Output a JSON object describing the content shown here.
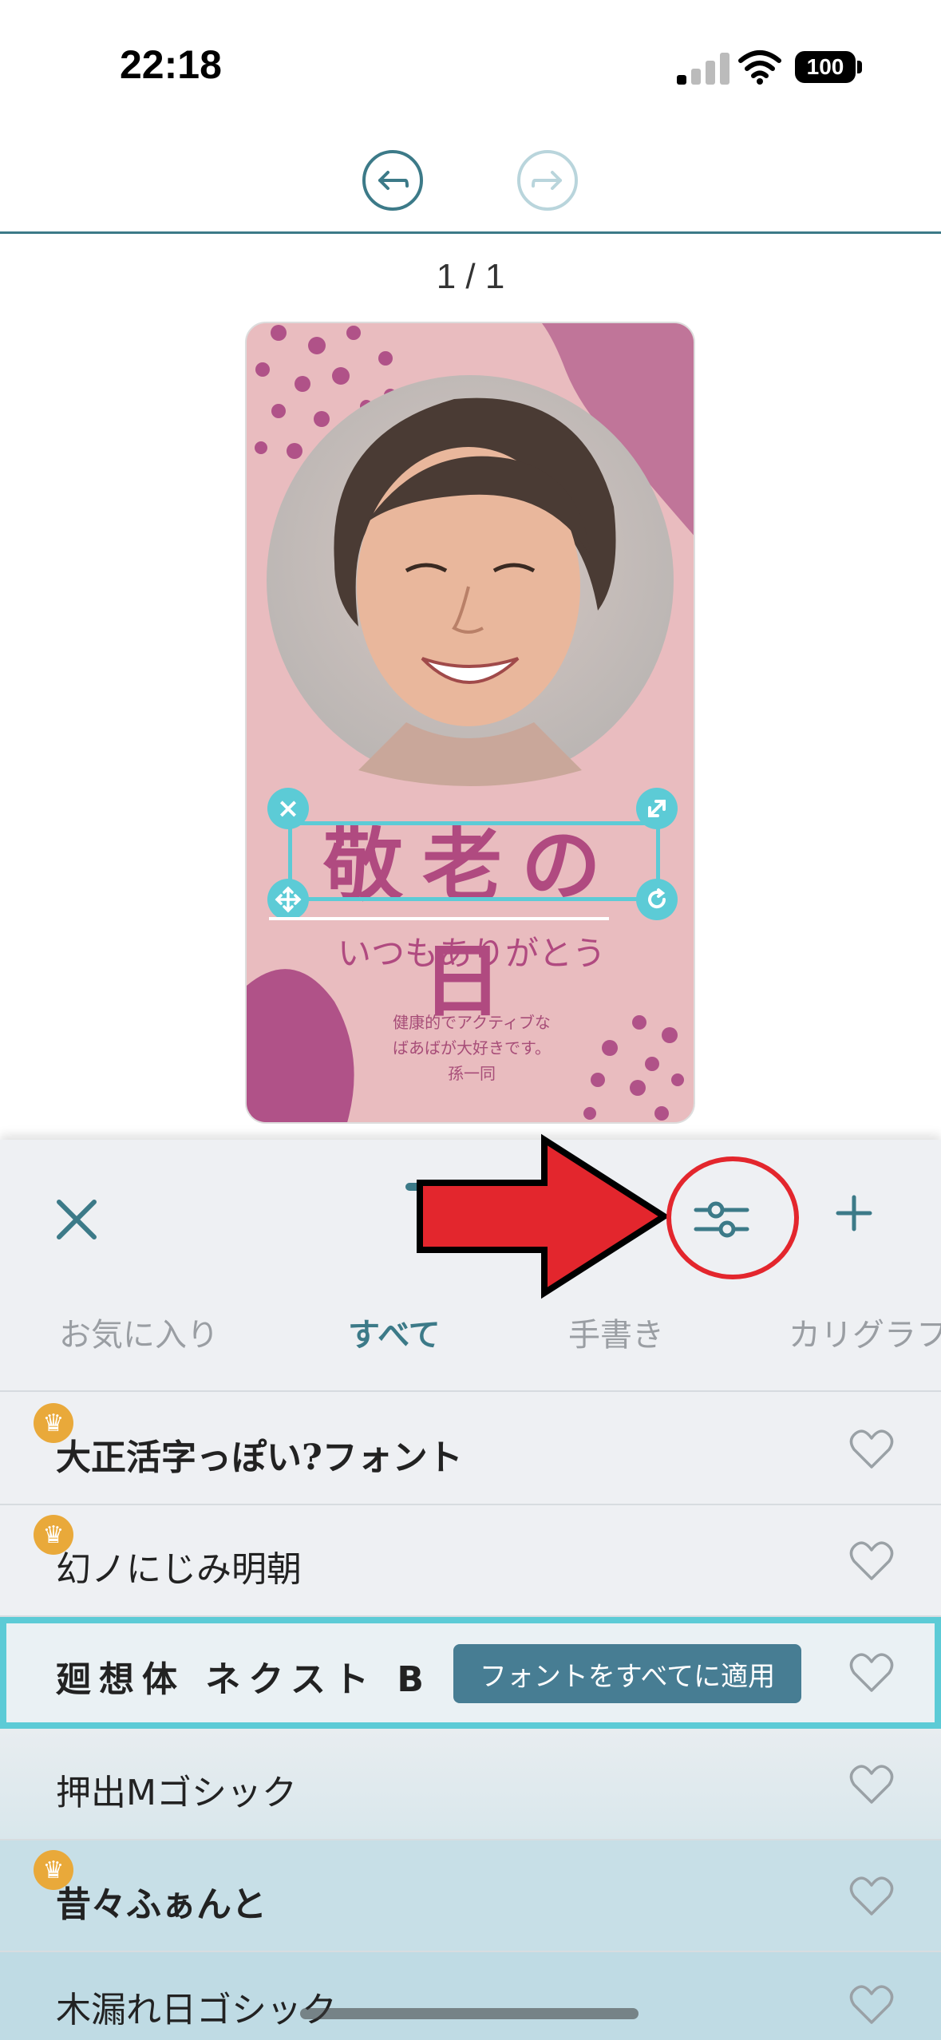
{
  "status_bar": {
    "time": "22:18",
    "battery": "100"
  },
  "page_counter": "1 / 1",
  "card": {
    "title": "敬老の日",
    "subtitle": "いつもありがとう",
    "message_lines": [
      "健康的でアクティブな",
      "ばあばが大好きです。",
      "孫一同"
    ]
  },
  "tabs": [
    {
      "label": "お気に入り",
      "active": false
    },
    {
      "label": "すべて",
      "active": true
    },
    {
      "label": "手書き",
      "active": false
    },
    {
      "label": "カリグラフ",
      "active": false
    }
  ],
  "fonts": [
    {
      "name": "大正活字っぽい?フォント",
      "premium": true,
      "selected": false
    },
    {
      "name": "幻ノにじみ明朝",
      "premium": true,
      "selected": false
    },
    {
      "name": "廻想体 ネクスト B",
      "premium": false,
      "selected": true
    },
    {
      "name": "押出Mゴシック",
      "premium": false,
      "selected": false
    },
    {
      "name": "昔々ふぁんと",
      "premium": true,
      "selected": false
    },
    {
      "name": "木漏れ日ゴシック",
      "premium": false,
      "selected": false
    }
  ],
  "apply_all_label": "フォントをすべてに適用",
  "colors": {
    "accent": "#3c7a88",
    "card_bg": "#e9bcbf",
    "card_text": "#b04a80",
    "selection": "#5ccbd6",
    "annotation_red": "#e3262d"
  }
}
